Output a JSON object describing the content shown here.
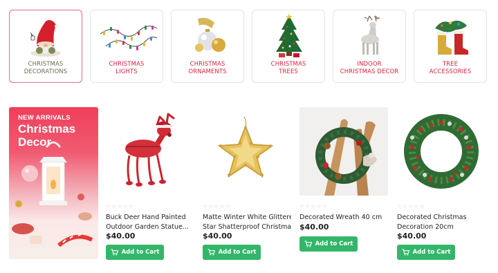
{
  "categories": [
    {
      "line1": "CHRISTMAS",
      "line2": "DECORATIONS",
      "icon": "gnome-icon",
      "active": true
    },
    {
      "line1": "CHRISTMAS",
      "line2": "LIGHTS",
      "icon": "string-lights-icon"
    },
    {
      "line1": "CHRISTMAS",
      "line2": "ORNAMENTS",
      "icon": "ornament-balls-icon"
    },
    {
      "line1": "CHRISTMAS",
      "line2": "TREES",
      "icon": "christmas-tree-icon"
    },
    {
      "line1": "INDOOR",
      "line2": "CHRISTMAS DECOR",
      "icon": "reindeer-icon"
    },
    {
      "line1": "TREE",
      "line2": "ACCESSORIES",
      "icon": "stocking-boot-icon"
    }
  ],
  "banner": {
    "tag": "NEW ARRIVALS",
    "title_line1": "Christmas",
    "title_line2": "Decor"
  },
  "products": [
    {
      "name_line1": "Buck Deer Hand Painted",
      "name_line2": "Outdoor Garden Statue...",
      "price": "$40.00",
      "rating": 0,
      "button": "Add to Cart",
      "image": "red-moose-icon"
    },
    {
      "name_line1": "Matte Winter White Glittered",
      "name_line2": "Star Shatterproof Christmas...",
      "price": "$40.00",
      "rating": 0,
      "button": "Add to Cart",
      "image": "gold-star-icon"
    },
    {
      "name_line1": "Decorated Wreath 40 cm",
      "name_line2": "",
      "price": "$40.00",
      "rating": 0,
      "button": "Add to Cart",
      "image": "wreath-icon"
    },
    {
      "name_line1": "Decorated Christmas",
      "name_line2": "Decoration 20cm",
      "price": "$40.00",
      "rating": 0,
      "button": "Add to Cart",
      "image": "berry-wreath-icon"
    }
  ],
  "colors": {
    "category_label": "#d8233c",
    "active_border": "#e46a86",
    "cart_button": "#33b66a",
    "banner_pink": "#f03f5b"
  }
}
